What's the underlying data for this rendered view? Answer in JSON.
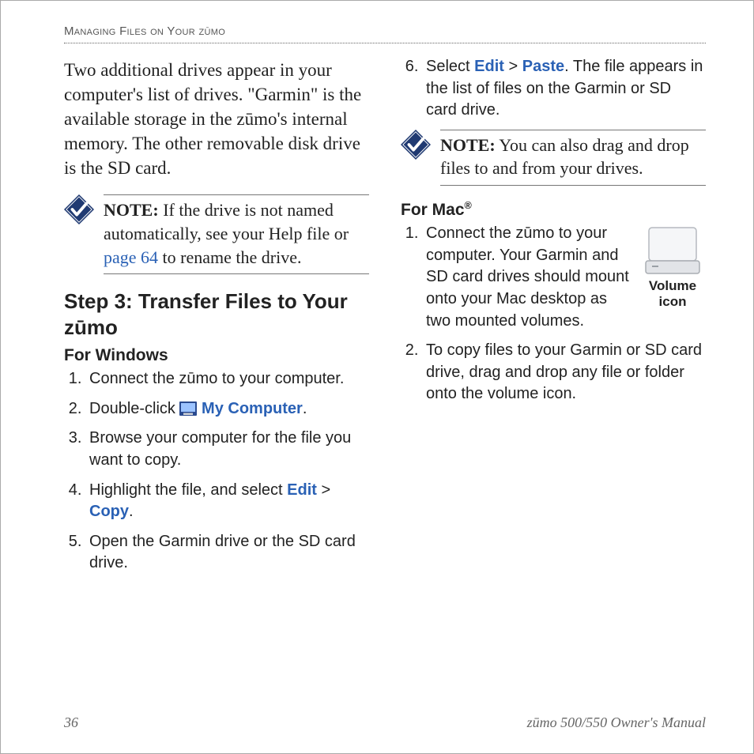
{
  "header": {
    "section_title": "Managing Files on Your zūmo"
  },
  "left": {
    "intro": "Two additional drives appear in your computer's list of drives. \"Garmin\" is the available storage in the zūmo's internal memory. The other removable disk drive is the SD card.",
    "note": {
      "label": "NOTE:",
      "before_link": " If the drive is not named automatically, see your Help file or ",
      "link": "page 64",
      "after_link": " to rename the drive."
    },
    "step_heading": "Step 3: Transfer Files to Your zūmo",
    "windows_heading": "For Windows",
    "windows_steps": {
      "s1": "Connect the zūmo to your computer.",
      "s2_before": "Double-click ",
      "s2_link": "My Computer",
      "s2_after": ".",
      "s3": "Browse your computer for the file you want to copy.",
      "s4_before": "Highlight the file, and select ",
      "s4_edit": "Edit",
      "s4_gt": " > ",
      "s4_copy": "Copy",
      "s4_after": ".",
      "s5": "Open the Garmin drive or the SD card drive."
    }
  },
  "right": {
    "step6_before": "Select ",
    "step6_edit": "Edit",
    "step6_gt": " > ",
    "step6_paste": "Paste",
    "step6_after": ". The file appears in the list of files on the Garmin or SD card drive.",
    "note": {
      "label": "NOTE:",
      "text": " You can also drag and drop files to and from your drives."
    },
    "mac_heading_before": "For Mac",
    "mac_heading_sup": "®",
    "mac_steps": {
      "s1": "Connect the zūmo to your computer. Your Garmin and SD card drives should mount onto your Mac desktop as two mounted volumes.",
      "s2": "To copy files to your Garmin or SD card drive, drag and drop any file or folder onto the volume icon."
    },
    "vol_caption_l1": "Volume",
    "vol_caption_l2": "icon"
  },
  "footer": {
    "page": "36",
    "manual": "zūmo 500/550 Owner's Manual"
  }
}
